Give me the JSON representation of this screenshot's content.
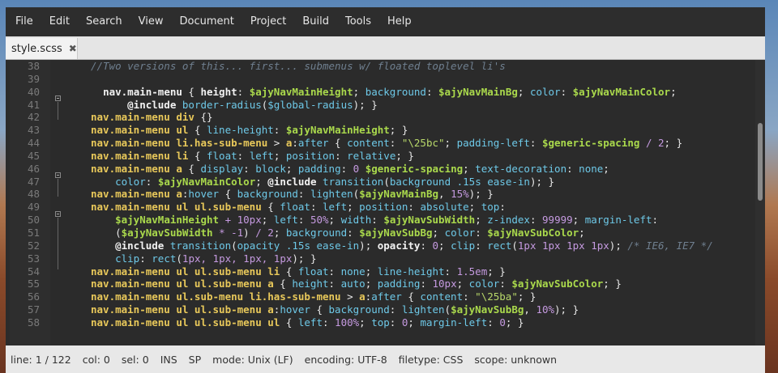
{
  "menubar": [
    "File",
    "Edit",
    "Search",
    "View",
    "Document",
    "Project",
    "Build",
    "Tools",
    "Help"
  ],
  "tab": {
    "label": "style.scss",
    "close_icon": "✖"
  },
  "gutter": [
    "38",
    "39",
    "40",
    "41",
    "42",
    "43",
    "44",
    "45",
    "46",
    "47",
    "48",
    "49",
    "50",
    "51",
    "52",
    "53",
    "54",
    "55",
    "56",
    "57",
    "58"
  ],
  "code": [
    [
      [
        "cm",
        "//Two versions of this... first... submenus w/ floated toplevel li's"
      ]
    ],
    [
      [
        "t",
        ""
      ]
    ],
    [
      [
        "t",
        "  "
      ],
      [
        "sel",
        "nav.main-menu"
      ],
      [
        "t",
        " { "
      ],
      [
        "kw",
        "height"
      ],
      [
        "t",
        ": "
      ],
      [
        "var",
        "$ajyNavMainHeight"
      ],
      [
        "t",
        "; "
      ],
      [
        "prop",
        "background"
      ],
      [
        "t",
        ": "
      ],
      [
        "var",
        "$ajyNavMainBg"
      ],
      [
        "t",
        "; "
      ],
      [
        "prop",
        "color"
      ],
      [
        "t",
        ": "
      ],
      [
        "var",
        "$ajyNavMainColor"
      ],
      [
        "t",
        ";"
      ]
    ],
    [
      [
        "t",
        "      "
      ],
      [
        "kw",
        "@include"
      ],
      [
        "t",
        " "
      ],
      [
        "prop",
        "border-radius"
      ],
      [
        "t",
        "("
      ],
      [
        "prop",
        "$global-radius"
      ],
      [
        "t",
        "); }"
      ]
    ],
    [
      [
        "sel2",
        "nav.main-menu div"
      ],
      [
        "t",
        " {}"
      ]
    ],
    [
      [
        "sel2",
        "nav.main-menu ul"
      ],
      [
        "t",
        " { "
      ],
      [
        "prop",
        "line-height"
      ],
      [
        "t",
        ": "
      ],
      [
        "var",
        "$ajyNavMainHeight"
      ],
      [
        "t",
        "; }"
      ]
    ],
    [
      [
        "sel2",
        "nav.main-menu li.has-sub-menu"
      ],
      [
        "t",
        " > "
      ],
      [
        "sel2",
        "a"
      ],
      [
        "t",
        ":"
      ],
      [
        "prop",
        "after"
      ],
      [
        "t",
        " { "
      ],
      [
        "prop",
        "content"
      ],
      [
        "t",
        ": "
      ],
      [
        "str",
        "\"\\25bc\""
      ],
      [
        "t",
        "; "
      ],
      [
        "prop",
        "padding-left"
      ],
      [
        "t",
        ": "
      ],
      [
        "var",
        "$generic-spacing"
      ],
      [
        "t",
        " "
      ],
      [
        "val",
        "/ 2"
      ],
      [
        "t",
        "; }"
      ]
    ],
    [
      [
        "sel2",
        "nav.main-menu li"
      ],
      [
        "t",
        " { "
      ],
      [
        "prop",
        "float"
      ],
      [
        "t",
        ": "
      ],
      [
        "prop",
        "left"
      ],
      [
        "t",
        "; "
      ],
      [
        "prop",
        "position"
      ],
      [
        "t",
        ": "
      ],
      [
        "prop",
        "relative"
      ],
      [
        "t",
        "; }"
      ]
    ],
    [
      [
        "sel2",
        "nav.main-menu a"
      ],
      [
        "t",
        " { "
      ],
      [
        "prop",
        "display"
      ],
      [
        "t",
        ": "
      ],
      [
        "prop",
        "block"
      ],
      [
        "t",
        "; "
      ],
      [
        "prop",
        "padding"
      ],
      [
        "t",
        ": "
      ],
      [
        "val",
        "0"
      ],
      [
        "t",
        " "
      ],
      [
        "var",
        "$generic-spacing"
      ],
      [
        "t",
        "; "
      ],
      [
        "prop",
        "text-decoration"
      ],
      [
        "t",
        ": "
      ],
      [
        "prop",
        "none"
      ],
      [
        "t",
        ";"
      ]
    ],
    [
      [
        "t",
        "    "
      ],
      [
        "prop",
        "color"
      ],
      [
        "t",
        ": "
      ],
      [
        "var",
        "$ajyNavMainColor"
      ],
      [
        "t",
        "; "
      ],
      [
        "kw",
        "@include"
      ],
      [
        "t",
        " "
      ],
      [
        "prop",
        "transition"
      ],
      [
        "t",
        "("
      ],
      [
        "prop",
        "background .15s ease-in"
      ],
      [
        "t",
        "); }"
      ]
    ],
    [
      [
        "sel2",
        "nav.main-menu a"
      ],
      [
        "t",
        ":"
      ],
      [
        "prop",
        "hover"
      ],
      [
        "t",
        " { "
      ],
      [
        "prop",
        "background"
      ],
      [
        "t",
        ": "
      ],
      [
        "prop",
        "lighten"
      ],
      [
        "t",
        "("
      ],
      [
        "var",
        "$ajyNavMainBg"
      ],
      [
        "t",
        ", "
      ],
      [
        "val",
        "15%"
      ],
      [
        "t",
        "); }"
      ]
    ],
    [
      [
        "sel2",
        "nav.main-menu ul ul.sub-menu"
      ],
      [
        "t",
        " { "
      ],
      [
        "prop",
        "float"
      ],
      [
        "t",
        ": "
      ],
      [
        "prop",
        "left"
      ],
      [
        "t",
        "; "
      ],
      [
        "prop",
        "position"
      ],
      [
        "t",
        ": "
      ],
      [
        "prop",
        "absolute"
      ],
      [
        "t",
        "; "
      ],
      [
        "prop",
        "top"
      ],
      [
        "t",
        ":"
      ]
    ],
    [
      [
        "t",
        "    "
      ],
      [
        "var",
        "$ajyNavMainHeight"
      ],
      [
        "t",
        " "
      ],
      [
        "val",
        "+ 10px"
      ],
      [
        "t",
        "; "
      ],
      [
        "prop",
        "left"
      ],
      [
        "t",
        ": "
      ],
      [
        "val",
        "50%"
      ],
      [
        "t",
        "; "
      ],
      [
        "prop",
        "width"
      ],
      [
        "t",
        ": "
      ],
      [
        "var",
        "$ajyNavSubWidth"
      ],
      [
        "t",
        "; "
      ],
      [
        "prop",
        "z-index"
      ],
      [
        "t",
        ": "
      ],
      [
        "val",
        "99999"
      ],
      [
        "t",
        "; "
      ],
      [
        "prop",
        "margin-left"
      ],
      [
        "t",
        ":"
      ]
    ],
    [
      [
        "t",
        "    ("
      ],
      [
        "var",
        "$ajyNavSubWidth"
      ],
      [
        "t",
        " "
      ],
      [
        "val",
        "* -1"
      ],
      [
        "t",
        ") "
      ],
      [
        "val",
        "/ 2"
      ],
      [
        "t",
        "; "
      ],
      [
        "prop",
        "background"
      ],
      [
        "t",
        ": "
      ],
      [
        "var",
        "$ajyNavSubBg"
      ],
      [
        "t",
        "; "
      ],
      [
        "prop",
        "color"
      ],
      [
        "t",
        ": "
      ],
      [
        "var",
        "$ajyNavSubColor"
      ],
      [
        "t",
        ";"
      ]
    ],
    [
      [
        "t",
        "    "
      ],
      [
        "kw",
        "@include"
      ],
      [
        "t",
        " "
      ],
      [
        "prop",
        "transition"
      ],
      [
        "t",
        "("
      ],
      [
        "prop",
        "opacity .15s ease-in"
      ],
      [
        "t",
        "); "
      ],
      [
        "kw",
        "opacity"
      ],
      [
        "t",
        ": "
      ],
      [
        "val",
        "0"
      ],
      [
        "t",
        "; "
      ],
      [
        "prop",
        "clip"
      ],
      [
        "t",
        ": "
      ],
      [
        "prop",
        "rect"
      ],
      [
        "t",
        "("
      ],
      [
        "val",
        "1px 1px 1px 1px"
      ],
      [
        "t",
        "); "
      ],
      [
        "cm",
        "/* IE6, IE7 */"
      ]
    ],
    [
      [
        "t",
        "    "
      ],
      [
        "prop",
        "clip"
      ],
      [
        "t",
        ": "
      ],
      [
        "prop",
        "rect"
      ],
      [
        "t",
        "("
      ],
      [
        "val",
        "1px, 1px, 1px, 1px"
      ],
      [
        "t",
        "); }"
      ]
    ],
    [
      [
        "sel2",
        "nav.main-menu ul ul.sub-menu li"
      ],
      [
        "t",
        " { "
      ],
      [
        "prop",
        "float"
      ],
      [
        "t",
        ": "
      ],
      [
        "prop",
        "none"
      ],
      [
        "t",
        "; "
      ],
      [
        "prop",
        "line-height"
      ],
      [
        "t",
        ": "
      ],
      [
        "val",
        "1.5em"
      ],
      [
        "t",
        "; }"
      ]
    ],
    [
      [
        "sel2",
        "nav.main-menu ul ul.sub-menu a"
      ],
      [
        "t",
        " { "
      ],
      [
        "prop",
        "height"
      ],
      [
        "t",
        ": "
      ],
      [
        "prop",
        "auto"
      ],
      [
        "t",
        "; "
      ],
      [
        "prop",
        "padding"
      ],
      [
        "t",
        ": "
      ],
      [
        "val",
        "10px"
      ],
      [
        "t",
        "; "
      ],
      [
        "prop",
        "color"
      ],
      [
        "t",
        ": "
      ],
      [
        "var",
        "$ajyNavSubColor"
      ],
      [
        "t",
        "; }"
      ]
    ],
    [
      [
        "sel2",
        "nav.main-menu ul.sub-menu li.has-sub-menu"
      ],
      [
        "t",
        " > "
      ],
      [
        "sel2",
        "a"
      ],
      [
        "t",
        ":"
      ],
      [
        "prop",
        "after"
      ],
      [
        "t",
        " { "
      ],
      [
        "prop",
        "content"
      ],
      [
        "t",
        ": "
      ],
      [
        "str",
        "\"\\25ba\""
      ],
      [
        "t",
        "; }"
      ]
    ],
    [
      [
        "sel2",
        "nav.main-menu ul ul.sub-menu a"
      ],
      [
        "t",
        ":"
      ],
      [
        "prop",
        "hover"
      ],
      [
        "t",
        " { "
      ],
      [
        "prop",
        "background"
      ],
      [
        "t",
        ": "
      ],
      [
        "prop",
        "lighten"
      ],
      [
        "t",
        "("
      ],
      [
        "var",
        "$ajyNavSubBg"
      ],
      [
        "t",
        ", "
      ],
      [
        "val",
        "10%"
      ],
      [
        "t",
        "); }"
      ]
    ],
    [
      [
        "sel2",
        "nav.main-menu ul ul.sub-menu ul"
      ],
      [
        "t",
        " { "
      ],
      [
        "prop",
        "left"
      ],
      [
        "t",
        ": "
      ],
      [
        "val",
        "100%"
      ],
      [
        "t",
        "; "
      ],
      [
        "prop",
        "top"
      ],
      [
        "t",
        ": "
      ],
      [
        "val",
        "0"
      ],
      [
        "t",
        "; "
      ],
      [
        "prop",
        "margin-left"
      ],
      [
        "t",
        ": "
      ],
      [
        "val",
        "0"
      ],
      [
        "t",
        "; }"
      ]
    ]
  ],
  "statusbar": [
    "line: 1 / 122",
    "col: 0",
    "sel: 0",
    "INS",
    "SP",
    "mode: Unix (LF)",
    "encoding: UTF-8",
    "filetype: CSS",
    "scope: unknown"
  ]
}
